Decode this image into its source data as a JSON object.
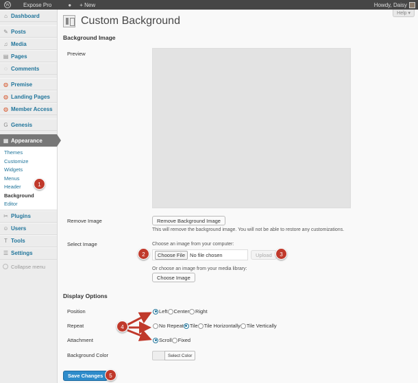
{
  "adminbar": {
    "site": "Expose Pro",
    "new": "+ New",
    "howdy": "Howdy, Daisy"
  },
  "sidebar": {
    "items": [
      {
        "label": "Dashboard",
        "icon": "⌂"
      },
      {
        "label": "Posts",
        "icon": "✎"
      },
      {
        "label": "Media",
        "icon": "♫"
      },
      {
        "label": "Pages",
        "icon": "▤"
      },
      {
        "label": "Comments",
        "icon": "◌"
      },
      {
        "label": "Premise",
        "icon": "◍"
      },
      {
        "label": "Landing Pages",
        "icon": "◍"
      },
      {
        "label": "Member Access",
        "icon": "◍"
      },
      {
        "label": "Genesis",
        "icon": "G"
      },
      {
        "label": "Appearance",
        "icon": "▦"
      },
      {
        "label": "Plugins",
        "icon": "✂"
      },
      {
        "label": "Users",
        "icon": "☺"
      },
      {
        "label": "Tools",
        "icon": "T"
      },
      {
        "label": "Settings",
        "icon": "☰"
      }
    ],
    "submenu": [
      "Themes",
      "Customize",
      "Widgets",
      "Menus",
      "Header",
      "Background",
      "Editor"
    ],
    "collapse": "Collapse menu"
  },
  "page": {
    "help": "Help ▾",
    "title": "Custom Background",
    "background_image": "Background Image",
    "preview": "Preview",
    "remove_image": "Remove Image",
    "remove_button": "Remove Background Image",
    "remove_note": "This will remove the background image. You will not be able to restore any customizations.",
    "select_image": "Select Image",
    "choose_computer": "Choose an image from your computer:",
    "choose_file": "Choose File",
    "no_file": "No file chosen",
    "upload": "Upload",
    "choose_library": "Or choose an image from your media library:",
    "choose_image": "Choose Image",
    "display_options": "Display Options",
    "position": "Position",
    "position_options": [
      "Left",
      "Center",
      "Right"
    ],
    "repeat": "Repeat",
    "repeat_options": [
      "No Repeat",
      "Tile",
      "Tile Horizontally",
      "Tile Vertically"
    ],
    "attachment": "Attachment",
    "attachment_options": [
      "Scroll",
      "Fixed"
    ],
    "background_color": "Background Color",
    "select_color": "Select Color",
    "save": "Save Changes"
  },
  "callouts": [
    "1",
    "2",
    "3",
    "4",
    "5"
  ],
  "colors": {
    "accent": "#21759b",
    "primary": "#2e8ccb",
    "callout": "#c0392b",
    "adminbar": "#464646"
  }
}
